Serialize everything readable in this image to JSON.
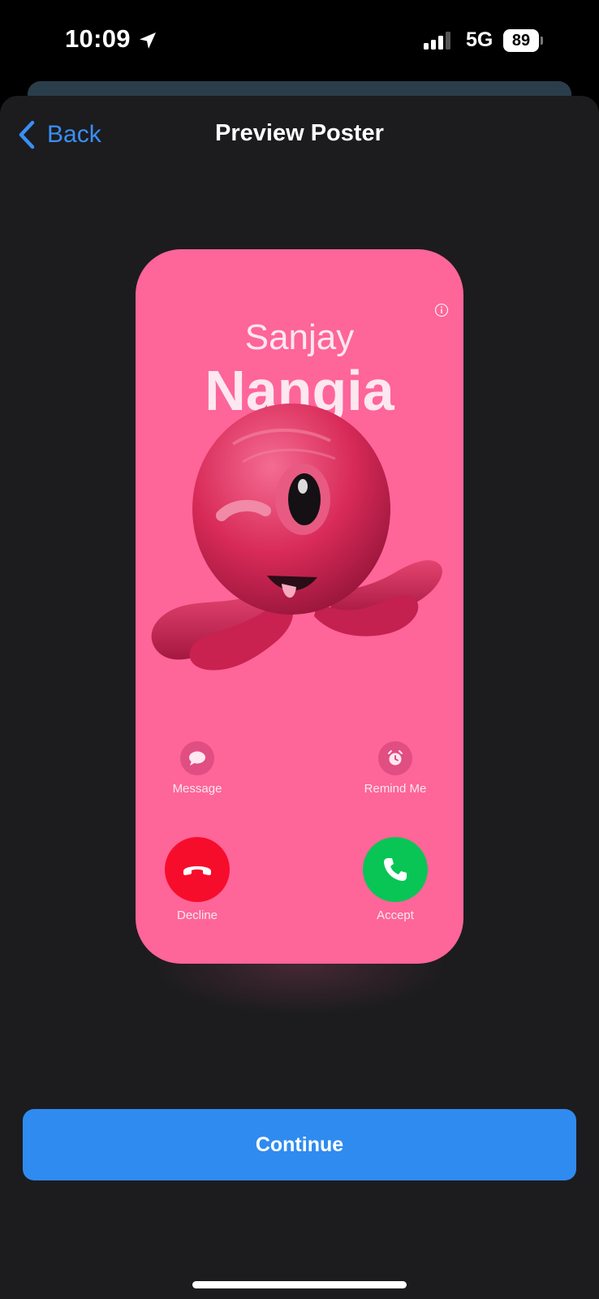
{
  "status_bar": {
    "time": "10:09",
    "network": "5G",
    "battery_level": "89"
  },
  "nav": {
    "back_label": "Back",
    "title": "Preview Poster"
  },
  "poster": {
    "first_name": "Sanjay",
    "last_name": "Nangia",
    "background_color": "#fe6599",
    "actions": {
      "message_label": "Message",
      "remind_label": "Remind Me",
      "decline_label": "Decline",
      "accept_label": "Accept"
    }
  },
  "footer": {
    "continue_label": "Continue"
  },
  "colors": {
    "accent": "#2f8bf0",
    "decline": "#f70d2c",
    "accept": "#08c556",
    "sheet": "#1c1c1e"
  }
}
